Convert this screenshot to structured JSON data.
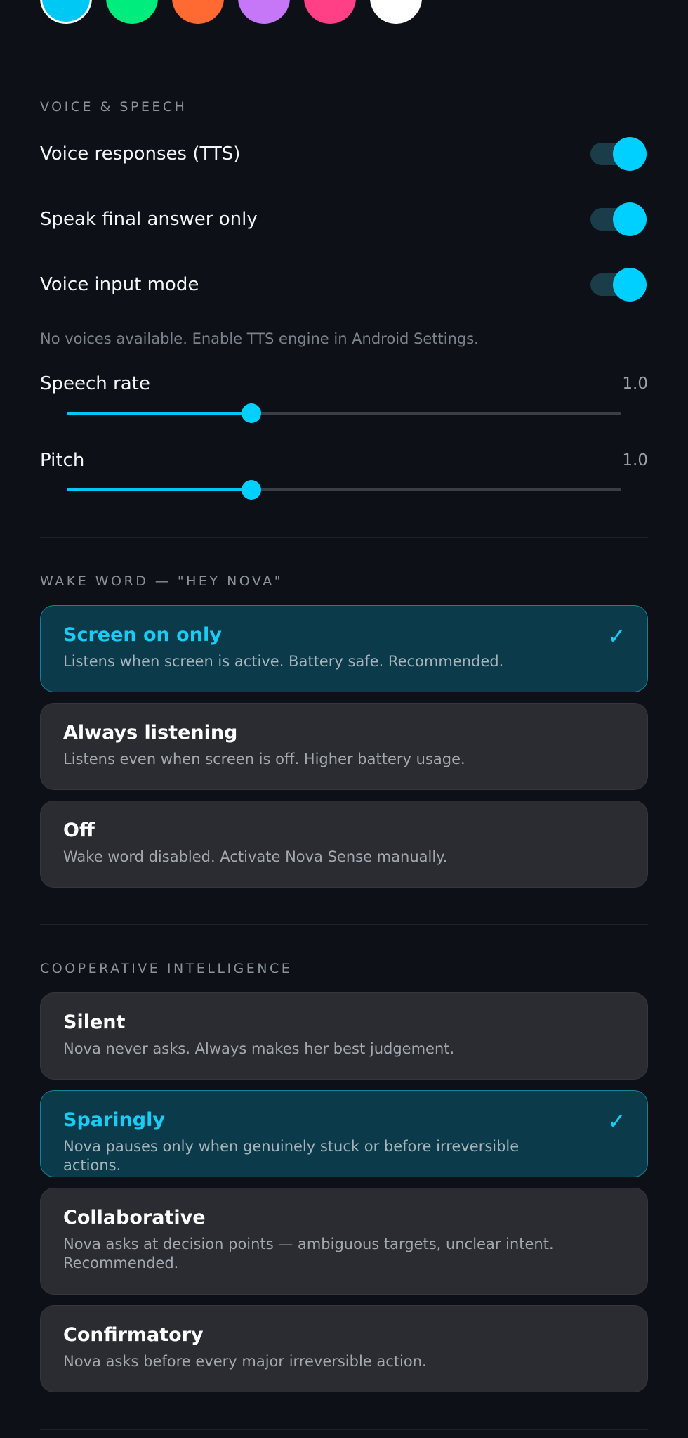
{
  "accent": {
    "swatches": [
      {
        "name": "cyan",
        "color": "#00c8f5",
        "selected": true
      },
      {
        "name": "green",
        "color": "#00ec7c",
        "selected": false
      },
      {
        "name": "orange",
        "color": "#ff6a33",
        "selected": false
      },
      {
        "name": "purple",
        "color": "#c577f7",
        "selected": false
      },
      {
        "name": "pink",
        "color": "#ff3f86",
        "selected": false
      },
      {
        "name": "white",
        "color": "#ffffff",
        "selected": false
      }
    ]
  },
  "voice": {
    "section_title": "VOICE & SPEECH",
    "toggles": [
      {
        "label": "Voice responses (TTS)",
        "on": true
      },
      {
        "label": "Speak final answer only",
        "on": true
      },
      {
        "label": "Voice input mode",
        "on": true
      }
    ],
    "note": "No voices available. Enable TTS engine in Android Settings.",
    "sliders": [
      {
        "label": "Speech rate",
        "value_text": "1.0",
        "fraction": 0.333
      },
      {
        "label": "Pitch",
        "value_text": "1.0",
        "fraction": 0.333
      }
    ]
  },
  "wake_word": {
    "section_title": "WAKE WORD — \"HEY NOVA\"",
    "options": [
      {
        "title": "Screen on only",
        "desc": "Listens when screen is active. Battery safe. Recommended.",
        "selected": true
      },
      {
        "title": "Always listening",
        "desc": "Listens even when screen is off. Higher battery usage.",
        "selected": false
      },
      {
        "title": "Off",
        "desc": "Wake word disabled. Activate Nova Sense manually.",
        "selected": false
      }
    ]
  },
  "cooperative": {
    "section_title": "COOPERATIVE INTELLIGENCE",
    "options": [
      {
        "title": "Silent",
        "desc": "Nova never asks. Always makes her best judgement.",
        "selected": false
      },
      {
        "title": "Sparingly",
        "desc": "Nova pauses only when genuinely stuck or before irreversible actions.",
        "selected": true
      },
      {
        "title": "Collaborative",
        "desc": "Nova asks at decision points — ambiguous targets, unclear intent. Recommended.",
        "selected": false
      },
      {
        "title": "Confirmatory",
        "desc": "Nova asks before every major irreversible action.",
        "selected": false
      }
    ]
  },
  "icons": {
    "check": "✓"
  }
}
